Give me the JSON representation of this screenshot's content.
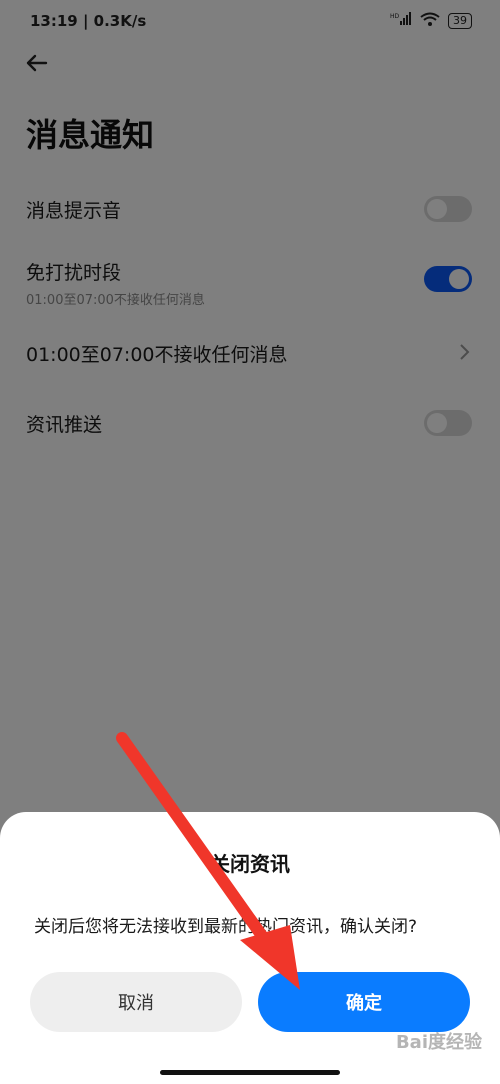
{
  "status_bar": {
    "time_speed": "13:19 | 0.3K/s",
    "network": "HD",
    "battery": "39"
  },
  "page": {
    "title": "消息通知"
  },
  "settings": [
    {
      "label": "消息提示音",
      "toggle": "off"
    },
    {
      "label": "免打扰时段",
      "sublabel": "01:00至07:00不接收任何消息",
      "toggle": "on"
    },
    {
      "label": "01:00至07:00不接收任何消息"
    },
    {
      "label": "资讯推送",
      "toggle": "off"
    }
  ],
  "dialog": {
    "title": "关闭资讯",
    "message": "关闭后您将无法接收到最新的热门资讯，确认关闭?",
    "cancel_label": "取消",
    "confirm_label": "确定"
  },
  "annotation": {
    "arrow_color": "#f0362a"
  },
  "colors": {
    "accent": "#0a7cff",
    "toggle_on": "#0a59f7"
  },
  "watermark": "Bai度经验"
}
